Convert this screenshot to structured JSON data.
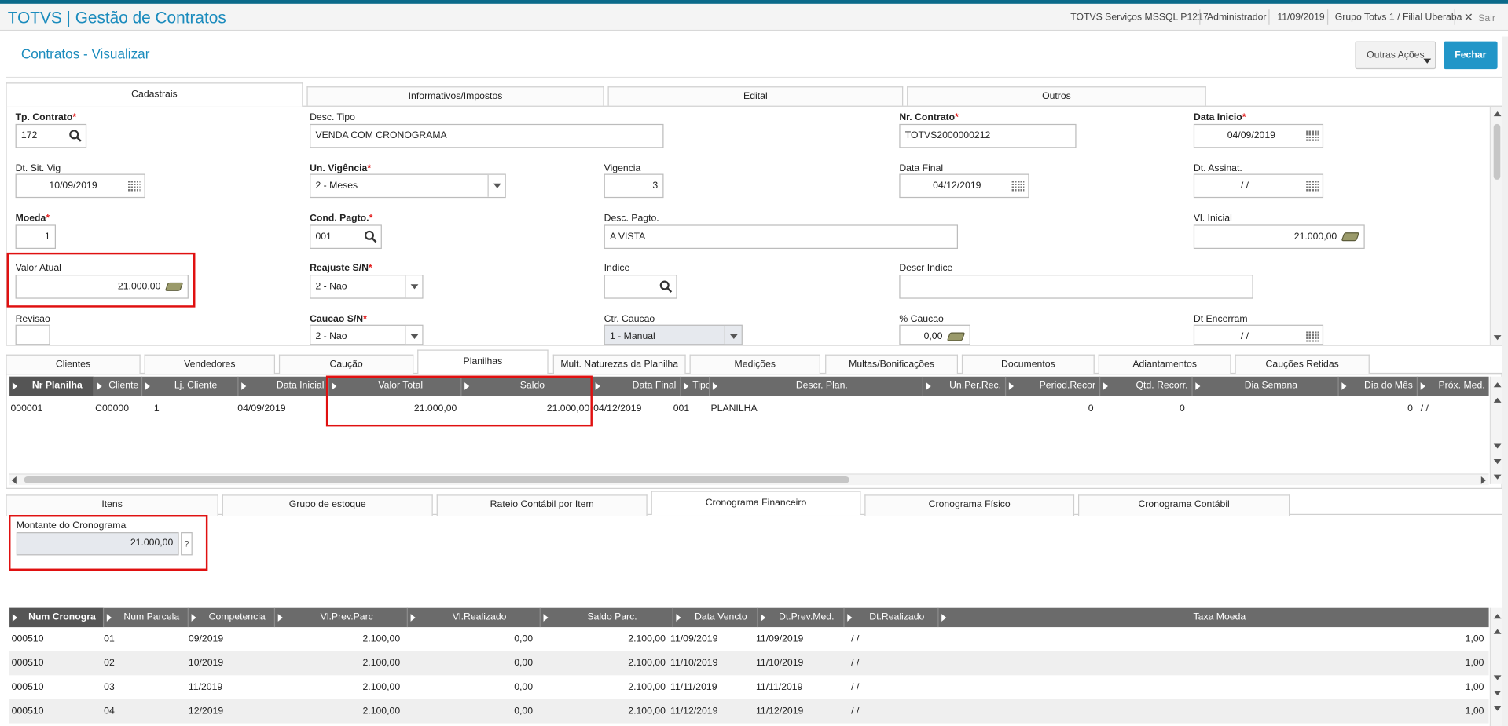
{
  "app": {
    "title": "TOTVS | Gestão de Contratos",
    "server": "TOTVS Serviços MSSQL P1217",
    "user": "Administrador",
    "date": "11/09/2019",
    "branch": "Grupo Totvs 1 / Filial Uberaba",
    "exit_label": "Sair"
  },
  "page": {
    "title": "Contratos - Visualizar",
    "other_actions_label": "Outras Ações",
    "close_label": "Fechar"
  },
  "main_tabs": [
    "Cadastrais",
    "Informativos/Impostos",
    "Edital",
    "Outros"
  ],
  "form": {
    "tp_contrato": {
      "label": "Tp. Contrato",
      "value": "172"
    },
    "desc_tipo": {
      "label": "Desc. Tipo",
      "value": "VENDA COM CRONOGRAMA"
    },
    "nr_contrato": {
      "label": "Nr. Contrato",
      "value": "TOTVS2000000212"
    },
    "data_inicio": {
      "label": "Data Inicio",
      "value": "04/09/2019"
    },
    "dt_sit_vig": {
      "label": "Dt. Sit. Vig",
      "value": "10/09/2019"
    },
    "un_vigencia": {
      "label": "Un. Vigência",
      "value": "2 - Meses"
    },
    "vigencia": {
      "label": "Vigencia",
      "value": "3"
    },
    "data_final": {
      "label": "Data Final",
      "value": "04/12/2019"
    },
    "dt_assinat": {
      "label": "Dt. Assinat.",
      "value": "/ /"
    },
    "moeda": {
      "label": "Moeda",
      "value": "1"
    },
    "cond_pagto": {
      "label": "Cond. Pagto.",
      "value": "001"
    },
    "desc_pagto": {
      "label": "Desc. Pagto.",
      "value": "A VISTA"
    },
    "vl_inicial": {
      "label": "Vl. Inicial",
      "value": "21.000,00"
    },
    "valor_atual": {
      "label": "Valor Atual",
      "value": "21.000,00"
    },
    "reajuste": {
      "label": "Reajuste S/N",
      "value": "2 - Nao"
    },
    "indice": {
      "label": "Indice",
      "value": ""
    },
    "descr_indice": {
      "label": "Descr Indice",
      "value": ""
    },
    "revisao": {
      "label": "Revisao",
      "value": ""
    },
    "caucao": {
      "label": "Caucao S/N",
      "value": "2 - Nao"
    },
    "ctr_caucao": {
      "label": "Ctr. Caucao",
      "value": "1 - Manual"
    },
    "pct_caucao": {
      "label": "% Caucao",
      "value": "0,00"
    },
    "dt_encerram": {
      "label": "Dt Encerram",
      "value": "/ /"
    }
  },
  "sub_tabs": [
    "Clientes",
    "Vendedores",
    "Caução",
    "Planilhas",
    "Mult. Naturezas da Planilha",
    "Medições",
    "Multas/Bonificações",
    "Documentos",
    "Adiantamentos",
    "Cauções Retidas"
  ],
  "planilhas": {
    "columns": [
      "Nr Planilha",
      "Cliente",
      "Lj. Cliente",
      "Data Inicial",
      "Valor Total",
      "Saldo",
      "Data Final",
      "Tipo",
      "Descr. Plan.",
      "Un.Per.Rec.",
      "Period.Recor",
      "Qtd. Recorr.",
      "Dia Semana",
      "Dia do Mês",
      "Próx. Med."
    ],
    "rows": [
      [
        "000001",
        "C00000",
        "1",
        "04/09/2019",
        "21.000,00",
        "21.000,00",
        "04/12/2019",
        "001",
        "PLANILHA",
        "",
        "0",
        "0",
        "",
        "0",
        "/ /"
      ]
    ]
  },
  "bottom_tabs": [
    "Itens",
    "Grupo de estoque",
    "Rateio Contábil por Item",
    "Cronograma Financeiro",
    "Cronograma Físico",
    "Cronograma Contábil"
  ],
  "montante": {
    "label": "Montante do Cronograma",
    "value": "21.000,00",
    "help": "?"
  },
  "cronograma": {
    "columns": [
      "Num Cronogra",
      "Num Parcela",
      "Competencia",
      "Vl.Prev.Parc",
      "Vl.Realizado",
      "Saldo Parc.",
      "Data Vencto",
      "Dt.Prev.Med.",
      "Dt.Realizado",
      "Taxa Moeda"
    ],
    "rows": [
      [
        "000510",
        "01",
        "09/2019",
        "2.100,00",
        "0,00",
        "2.100,00",
        "11/09/2019",
        "11/09/2019",
        "/ /",
        "1,00"
      ],
      [
        "000510",
        "02",
        "10/2019",
        "2.100,00",
        "0,00",
        "2.100,00",
        "11/10/2019",
        "11/10/2019",
        "/ /",
        "1,00"
      ],
      [
        "000510",
        "03",
        "11/2019",
        "2.100,00",
        "0,00",
        "2.100,00",
        "11/11/2019",
        "11/11/2019",
        "/ /",
        "1,00"
      ],
      [
        "000510",
        "04",
        "12/2019",
        "2.100,00",
        "0,00",
        "2.100,00",
        "11/12/2019",
        "11/12/2019",
        "/ /",
        "1,00"
      ]
    ]
  }
}
